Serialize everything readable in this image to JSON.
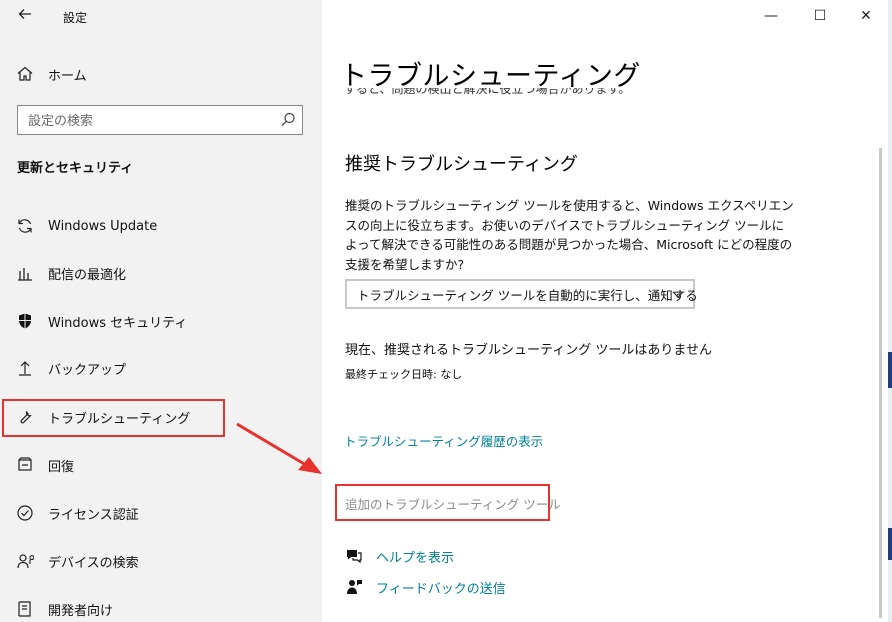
{
  "window": {
    "title": "設定",
    "controls": {
      "minimize": "—",
      "maximize": "☐",
      "close": "✕"
    }
  },
  "sidebar": {
    "home_label": "ホーム",
    "search_placeholder": "設定の検索",
    "section_title": "更新とセキュリティ",
    "items": [
      {
        "label": "Windows Update",
        "icon": "sync-icon"
      },
      {
        "label": "配信の最適化",
        "icon": "delivery-optimization-icon"
      },
      {
        "label": "Windows セキュリティ",
        "icon": "shield-icon"
      },
      {
        "label": "バックアップ",
        "icon": "backup-arrow-icon"
      },
      {
        "label": "トラブルシューティング",
        "icon": "wrench-icon"
      },
      {
        "label": "回復",
        "icon": "recovery-icon"
      },
      {
        "label": "ライセンス認証",
        "icon": "check-circle-icon"
      },
      {
        "label": "デバイスの検索",
        "icon": "person-location-icon"
      },
      {
        "label": "開発者向け",
        "icon": "developer-icon"
      }
    ],
    "selected_index": 4
  },
  "main": {
    "page_title": "トラブルシューティング",
    "partial_text": "すると、問題の検出と解決に役立つ場合があります。",
    "recommended_heading": "推奨トラブルシューティング",
    "description": "推奨のトラブルシューティング ツールを使用すると、Windows エクスペリエンスの向上に役立ちます。お使いのデバイスでトラブルシューティング ツールによって解決できる可能性のある問題が見つかった場合、Microsoft にどの程度の支援を希望しますか?",
    "dropdown_value": "トラブルシューティング ツールを自動的に実行し、通知する",
    "status": "現在、推奨されるトラブルシューティング ツールはありません",
    "last_check": "最終チェック日時: なし",
    "history_link": "トラブルシューティング履歴の表示",
    "additional_link": "追加のトラブルシューティング ツール",
    "help_link": "ヘルプを表示",
    "feedback_link": "フィードバックの送信"
  },
  "colors": {
    "highlight": "#e8322d",
    "link": "#008296",
    "sidebar_bg": "#f2f2f2"
  }
}
